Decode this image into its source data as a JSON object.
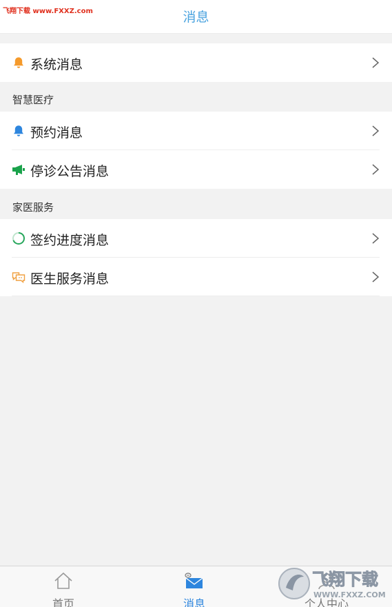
{
  "header": {
    "title": "消息",
    "watermark": "飞翔下载 www.FXXZ.com"
  },
  "system": {
    "label": "系统消息",
    "icon": "bell-icon",
    "icon_color": "#f59a2b"
  },
  "smart_medical": {
    "section_title": "智慧医疗",
    "items": [
      {
        "label": "预约消息",
        "icon": "bell-icon",
        "icon_color": "#2e86de"
      },
      {
        "label": "停诊公告消息",
        "icon": "megaphone-icon",
        "icon_color": "#1aa24b"
      }
    ]
  },
  "family_doctor": {
    "section_title": "家医服务",
    "items": [
      {
        "label": "签约进度消息",
        "icon": "progress-circle-icon",
        "icon_color": "#26a65b"
      },
      {
        "label": "医生服务消息",
        "icon": "chat-bubbles-icon",
        "icon_color": "#f0a040"
      }
    ]
  },
  "tabbar": {
    "tabs": [
      {
        "label": "首页",
        "icon": "home-icon",
        "active": false
      },
      {
        "label": "消息",
        "icon": "mail-icon",
        "active": true
      },
      {
        "label": "个人中心",
        "icon": "person-icon",
        "active": false
      }
    ],
    "active_color": "#2e86de",
    "inactive_color": "#777777"
  },
  "watermark_bottom": {
    "title": "飞翔下载",
    "url": "WWW.FXXZ.COM"
  }
}
